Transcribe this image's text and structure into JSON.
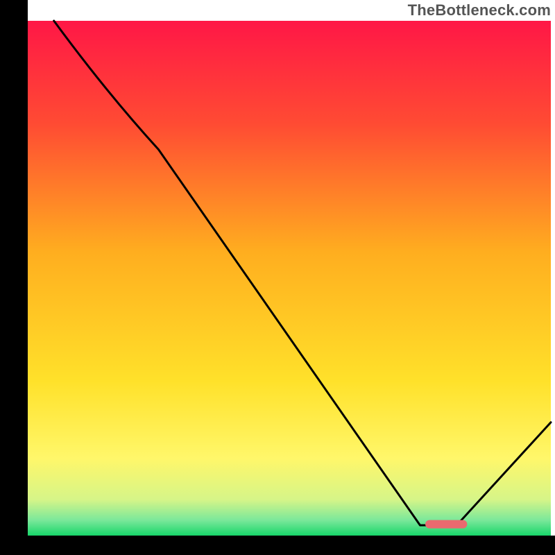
{
  "watermark": "TheBottleneck.com",
  "chart_data": {
    "type": "line",
    "title": "",
    "xlabel": "",
    "ylabel": "",
    "xlim": [
      0,
      100
    ],
    "ylim": [
      0,
      100
    ],
    "series": [
      {
        "name": "curve",
        "x": [
          5,
          25,
          75,
          82,
          100
        ],
        "y": [
          100,
          75,
          2,
          2,
          22
        ]
      }
    ],
    "marker_segment": {
      "x0": 76,
      "x1": 84,
      "y": 2.2
    },
    "gradient_stops": [
      {
        "offset": 0.0,
        "color": "#ff1746"
      },
      {
        "offset": 0.2,
        "color": "#ff4b33"
      },
      {
        "offset": 0.45,
        "color": "#ffae1f"
      },
      {
        "offset": 0.7,
        "color": "#ffe12a"
      },
      {
        "offset": 0.85,
        "color": "#fff76a"
      },
      {
        "offset": 0.93,
        "color": "#d6f588"
      },
      {
        "offset": 0.97,
        "color": "#7be89a"
      },
      {
        "offset": 1.0,
        "color": "#18d66a"
      }
    ],
    "axis_color": "#000000",
    "curve_color": "#000000",
    "marker_color": "#e96a6f"
  }
}
